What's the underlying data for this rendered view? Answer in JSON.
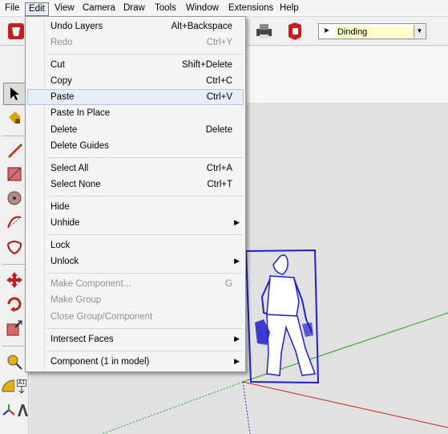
{
  "menubar": {
    "items": [
      "File",
      "Edit",
      "View",
      "Camera",
      "Draw",
      "Tools",
      "Window",
      "Extensions",
      "Help"
    ],
    "active": "Edit"
  },
  "toolbar": {
    "scene_selector": {
      "value": "Dinding"
    }
  },
  "edit_menu": {
    "items": [
      {
        "label": "Undo Layers",
        "shortcut": "Alt+Backspace"
      },
      {
        "label": "Redo",
        "shortcut": "Ctrl+Y"
      },
      {
        "label": "Cut",
        "shortcut": "Shift+Delete"
      },
      {
        "label": "Copy",
        "shortcut": "Ctrl+C"
      },
      {
        "label": "Paste",
        "shortcut": "Ctrl+V"
      },
      {
        "label": "Paste In Place",
        "shortcut": ""
      },
      {
        "label": "Delete",
        "shortcut": "Delete"
      },
      {
        "label": "Delete Guides",
        "shortcut": ""
      },
      {
        "label": "Select All",
        "shortcut": "Ctrl+A"
      },
      {
        "label": "Select None",
        "shortcut": "Ctrl+T"
      },
      {
        "label": "Hide",
        "shortcut": ""
      },
      {
        "label": "Unhide",
        "shortcut": ""
      },
      {
        "label": "Lock",
        "shortcut": ""
      },
      {
        "label": "Unlock",
        "shortcut": ""
      },
      {
        "label": "Make Component...",
        "shortcut": "G"
      },
      {
        "label": "Make Group",
        "shortcut": ""
      },
      {
        "label": "Close Group/Component",
        "shortcut": ""
      },
      {
        "label": "Intersect Faces",
        "shortcut": ""
      },
      {
        "label": "Component (1 in model)",
        "shortcut": ""
      }
    ]
  },
  "palette": {
    "text_tool_label": "A1"
  },
  "colors": {
    "selection_blue": "#1f1fcc",
    "axis_red": "#cc2222",
    "axis_green": "#22aa22",
    "highlight": "#e8eef7"
  }
}
